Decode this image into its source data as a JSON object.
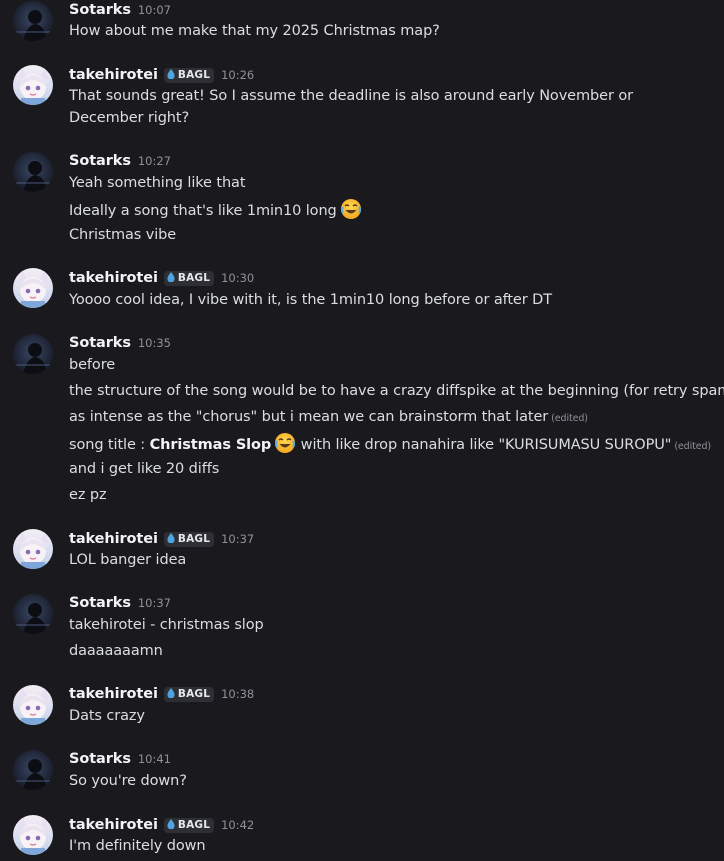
{
  "channel": {
    "messages": [
      {
        "author": "Sotarks",
        "time": "10:07",
        "lines": [
          "How about me make that my 2025 Christmas map?"
        ]
      },
      {
        "author": "takehirotei",
        "badge": "BAGL",
        "time": "10:26",
        "lines": [
          "That sounds great! So I assume the deadline is also around early November or December right?"
        ]
      },
      {
        "author": "Sotarks",
        "time": "10:27",
        "lines": [
          "Yeah something like that",
          "Ideally a song that's like 1min10 long",
          "Christmas vibe"
        ]
      },
      {
        "author": "takehirotei",
        "badge": "BAGL",
        "time": "10:30",
        "lines": [
          "Yoooo cool idea, I vibe with it, is the 1min10 long before or after DT"
        ]
      },
      {
        "author": "Sotarks",
        "time": "10:35",
        "lines": [
          "before",
          "the structure of the song would be to have a crazy diffspike at the beginning (for retry spam)",
          "as intense as the \"chorus\" but i mean we can brainstorm that later",
          "and i get like 20 diffs",
          "ez pz"
        ],
        "edited_label": "(edited)",
        "title_line": {
          "prefix": "song title : ",
          "bold": "Christmas Slop",
          "suffix": " with like  drop nanahira like \"KURISUMASU SUROPU\""
        }
      },
      {
        "author": "takehirotei",
        "badge": "BAGL",
        "time": "10:37",
        "lines": [
          "LOL banger idea"
        ]
      },
      {
        "author": "Sotarks",
        "time": "10:37",
        "lines": [
          "takehirotei - christmas slop",
          "daaaaaaamn"
        ]
      },
      {
        "author": "takehirotei",
        "badge": "BAGL",
        "time": "10:38",
        "lines": [
          "Dats crazy"
        ]
      },
      {
        "author": "Sotarks",
        "time": "10:41",
        "lines": [
          "So you're down?"
        ]
      },
      {
        "author": "takehirotei",
        "badge": "BAGL",
        "time": "10:42",
        "lines": [
          "I'm definitely down"
        ]
      }
    ]
  },
  "icons": {
    "badge": "water-drop-icon",
    "emoji": "joy-emoji-icon"
  },
  "colors": {
    "background": "#1a1a1e",
    "username": "#f2f3f5",
    "text": "#dbdee1",
    "muted": "#8e9297",
    "badge_bg": "#2e2f34",
    "drop": "#4fa3e0"
  }
}
